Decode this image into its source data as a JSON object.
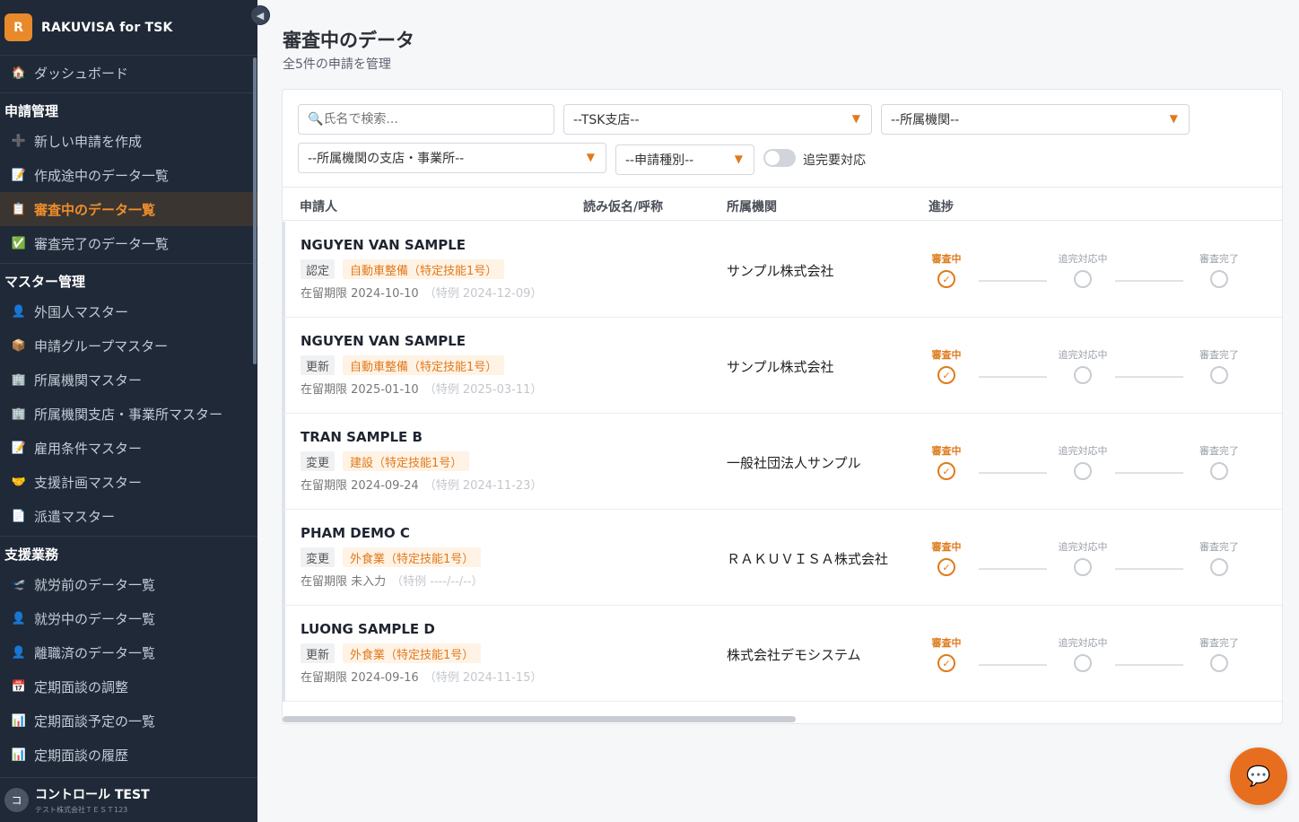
{
  "brand": {
    "logo_letter": "R",
    "name": "RAKUVISA for TSK"
  },
  "sidebar": {
    "dashboard": "ダッシュボード",
    "sections": [
      {
        "title": "申請管理",
        "items": [
          {
            "label": "新しい申請を作成",
            "icon": "plus-icon"
          },
          {
            "label": "作成途中のデータ一覧",
            "icon": "memo-icon"
          },
          {
            "label": "審査中のデータ一覧",
            "icon": "clipboard-icon",
            "active": true
          },
          {
            "label": "審査完了のデータ一覧",
            "icon": "check-icon"
          }
        ]
      },
      {
        "title": "マスター管理",
        "items": [
          {
            "label": "外国人マスター",
            "icon": "person-icon"
          },
          {
            "label": "申請グループマスター",
            "icon": "package-icon"
          },
          {
            "label": "所属機関マスター",
            "icon": "building-icon"
          },
          {
            "label": "所属機関支店・事業所マスター",
            "icon": "building-icon"
          },
          {
            "label": "雇用条件マスター",
            "icon": "memo-icon"
          },
          {
            "label": "支援計画マスター",
            "icon": "handshake-icon"
          },
          {
            "label": "派遣マスター",
            "icon": "document-icon"
          }
        ]
      },
      {
        "title": "支援業務",
        "items": [
          {
            "label": "就労前のデータ一覧",
            "icon": "plane-icon"
          },
          {
            "label": "就労中のデータ一覧",
            "icon": "person-icon"
          },
          {
            "label": "離職済のデータ一覧",
            "icon": "person-icon"
          },
          {
            "label": "定期面談の調整",
            "icon": "calendar-icon"
          },
          {
            "label": "定期面談予定の一覧",
            "icon": "chart-icon"
          },
          {
            "label": "定期面談の履歴",
            "icon": "chart-icon"
          }
        ]
      }
    ],
    "user": {
      "avatar": "コ",
      "name": "コントロール TEST",
      "org": "テスト株式会社ＴＥＳＴ123"
    }
  },
  "page": {
    "title": "審査中のデータ",
    "subtitle": "全5件の申請を管理"
  },
  "filters": {
    "search_placeholder": "氏名で検索...",
    "branch": "--TSK支店--",
    "org": "--所属機関--",
    "org_branch": "--所属機関の支店・事業所--",
    "app_type": "--申請種別--",
    "toggle_label": "追完要対応"
  },
  "table": {
    "headers": [
      "申請人",
      "読み仮名/呼称",
      "所属機関",
      "進捗"
    ],
    "steps": [
      "審査中",
      "追完対応中",
      "審査完了"
    ],
    "rows": [
      {
        "name": "NGUYEN VAN SAMPLE",
        "type": "認定",
        "category": "自動車整備（特定技能1号）",
        "period": "在留期限 2024-10-10",
        "tokurei": "（特例 2024-12-09）",
        "org": "サンプル株式会社"
      },
      {
        "name": "NGUYEN VAN SAMPLE",
        "type": "更新",
        "category": "自動車整備（特定技能1号）",
        "period": "在留期限 2025-01-10",
        "tokurei": "（特例 2025-03-11）",
        "org": "サンプル株式会社"
      },
      {
        "name": "TRAN SAMPLE B",
        "type": "変更",
        "category": "建設（特定技能1号）",
        "period": "在留期限 2024-09-24",
        "tokurei": "（特例 2024-11-23）",
        "org": "一般社団法人サンプル"
      },
      {
        "name": "PHAM DEMO C",
        "type": "変更",
        "category": "外食業（特定技能1号）",
        "period": "在留期限 未入力",
        "tokurei": "（特例 ----/--/--）",
        "org": "ＲＡＫＵＶＩＳＡ株式会社"
      },
      {
        "name": "LUONG SAMPLE D",
        "type": "更新",
        "category": "外食業（特定技能1号）",
        "period": "在留期限 2024-09-16",
        "tokurei": "（特例 2024-11-15）",
        "org": "株式会社デモシステム"
      }
    ]
  },
  "colors": {
    "accent": "#e07a1c",
    "sidebar_bg": "#1f2937"
  }
}
